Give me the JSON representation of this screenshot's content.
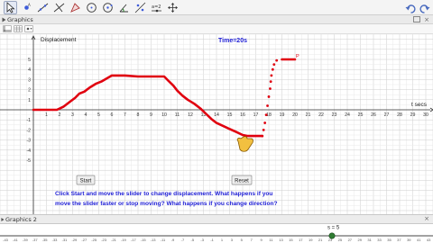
{
  "toolbar": {
    "tools": [
      {
        "icon": "move-arrow-icon",
        "active": true
      },
      {
        "icon": "point-icon",
        "active": false
      },
      {
        "icon": "line-icon",
        "active": false
      },
      {
        "icon": "perpendicular-icon",
        "active": false
      },
      {
        "icon": "polygon-icon",
        "active": false
      },
      {
        "icon": "circle-icon",
        "active": false
      },
      {
        "icon": "circle-center-icon",
        "active": false
      },
      {
        "icon": "angle-icon",
        "active": false
      },
      {
        "icon": "reflect-icon",
        "active": false
      },
      {
        "icon": "slider-icon",
        "active": false
      },
      {
        "icon": "move-view-icon",
        "active": false
      }
    ],
    "undo_icon": "undo-icon",
    "redo_icon": "redo-icon"
  },
  "panel": {
    "title": "Graphics",
    "close_glyph": "×"
  },
  "bottom_panel": {
    "title": "Graphics 2",
    "close_glyph": "×"
  },
  "graph": {
    "y_axis_label": "Displacement",
    "x_axis_label": "t secs",
    "time_text": "Time=20s",
    "point_label": "P",
    "instructions_line1": "Click Start and move the slider to change displacement. What happens if you",
    "instructions_line2": "move the slider faster or stop moving? What happens if you change direction?",
    "start_button": "Start",
    "reset_button": "Reset",
    "colors": {
      "curve": "#e0000f",
      "label": "#1f1fd6",
      "grid_minor": "#e9e9e9",
      "grid_major": "#cdcdcd",
      "hand": "#f2c040"
    }
  },
  "slider": {
    "label": "s = 5",
    "value": 5,
    "min": -5,
    "max": 5,
    "color": "#2f7d32"
  },
  "chart_data": {
    "type": "line",
    "x_ticks": [
      1,
      2,
      3,
      4,
      5,
      6,
      7,
      8,
      9,
      10,
      11,
      12,
      13,
      14,
      15,
      16,
      17,
      18,
      19,
      20,
      21,
      22,
      23,
      24,
      25,
      26,
      27,
      28,
      29,
      30
    ],
    "y_ticks": [
      -5,
      -4,
      -3,
      -2,
      -1,
      1,
      2,
      3,
      4,
      5
    ],
    "xlim": [
      0,
      31
    ],
    "ylim": [
      -5.5,
      5.5
    ],
    "series": [
      {
        "x": [
          0,
          1,
          1.8,
          2.3,
          2.8,
          3.2,
          3.5,
          3.9,
          4.3,
          4.8,
          5.2,
          5.6,
          6,
          7,
          8,
          9,
          10,
          10.3,
          10.7,
          11,
          11.4,
          11.8,
          12.3,
          12.8,
          13.2,
          13.6,
          14,
          14.5,
          15,
          15.5,
          16,
          16.4,
          16.8,
          17,
          17.2,
          17.5
        ],
        "y": [
          0,
          0,
          0,
          0.3,
          0.8,
          1.2,
          1.6,
          1.8,
          2.2,
          2.6,
          2.8,
          3.1,
          3.4,
          3.4,
          3.3,
          3.3,
          3.3,
          2.9,
          2.4,
          1.9,
          1.4,
          1.0,
          0.6,
          0.1,
          -0.4,
          -0.9,
          -1.3,
          -1.6,
          -1.9,
          -2.2,
          -2.5,
          -2.6,
          -2.6,
          -2.6,
          -2.6,
          -2.6
        ]
      },
      {
        "x": [
          17.5,
          17.6,
          17.7,
          17.8,
          17.9,
          18.0,
          18.1,
          18.15,
          18.2,
          18.3,
          18.4,
          18.6,
          19,
          19.5,
          20
        ],
        "y": [
          -2.6,
          -2.0,
          -1.3,
          -0.5,
          0.4,
          1.3,
          2.1,
          2.8,
          3.4,
          4.0,
          4.5,
          4.9,
          5,
          5,
          5
        ]
      }
    ]
  },
  "graph2_ticks": [
    "-43",
    "-41",
    "-39",
    "-37",
    "-35",
    "-33",
    "-31",
    "-29",
    "-27",
    "-25",
    "-23",
    "-21",
    "-19",
    "-17",
    "-15",
    "-13",
    "-11",
    "-9",
    "-7",
    "-5",
    "-3",
    "-1",
    "1",
    "3",
    "5",
    "7",
    "9",
    "11",
    "13",
    "15",
    "17",
    "19",
    "21",
    "23",
    "25",
    "27",
    "29",
    "31",
    "33",
    "35",
    "37",
    "39",
    "41",
    "43"
  ]
}
